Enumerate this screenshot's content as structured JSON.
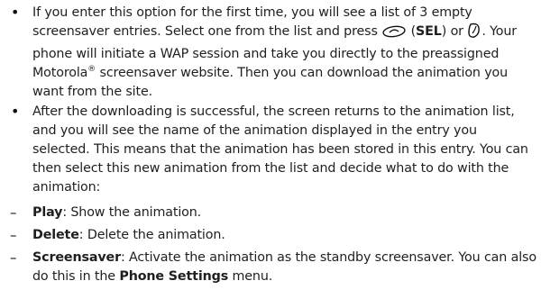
{
  "bullets": [
    {
      "seg1": "If you enter this option for the first time, you will see a list of 3 empty screensaver entries. Select one from the list and press",
      "sel_paren_open": "(",
      "sel_label": "SEL",
      "sel_paren_close": ") or",
      "seg2": ". Your phone will initiate a WAP session and take you directly to the preassigned Motorola",
      "reg_mark": "®",
      "seg3": "screensaver website. Then you can download the animation you want from the site."
    },
    {
      "text": "After the downloading is successful, the screen returns to the animation list, and you will see the name of the animation displayed in the entry you selected. This means that the animation has been stored in this entry. You can then select this new animation from the list and decide what to do with the animation:"
    }
  ],
  "options": [
    {
      "term": "Play",
      "desc": ": Show the animation."
    },
    {
      "term": "Delete",
      "desc": ": Delete the animation."
    },
    {
      "term": "Screensaver",
      "desc": ": Activate the animation as the standby screensaver. You can also do this in the",
      "menu": "Phone Settings",
      "tail": "menu."
    }
  ],
  "markers": {
    "bullet": "•",
    "dash": "–"
  },
  "icons": {
    "softkey": "left-softkey-icon",
    "select_key": "select-key-icon"
  }
}
